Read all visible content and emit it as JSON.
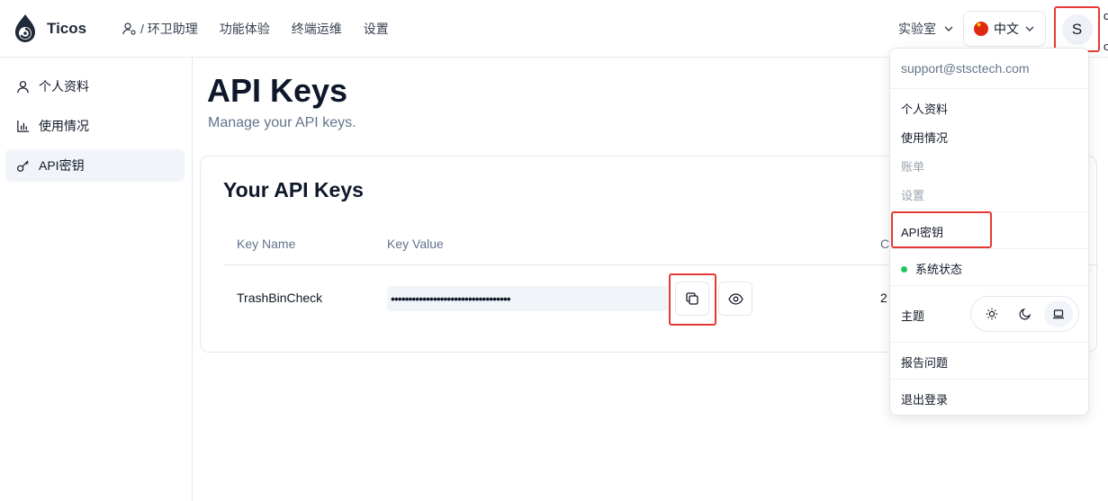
{
  "app": {
    "name": "Ticos"
  },
  "nav": {
    "items": [
      {
        "label": "/ 环卫助理"
      },
      {
        "label": "功能体验"
      },
      {
        "label": "终端运维"
      },
      {
        "label": "设置"
      }
    ],
    "lab_label": "实验室",
    "language_label": "中文",
    "avatar_initial": "S"
  },
  "sidebar": {
    "items": [
      {
        "label": "个人资料",
        "icon": "user-icon"
      },
      {
        "label": "使用情况",
        "icon": "bar-chart-icon"
      },
      {
        "label": "API密钥",
        "icon": "key-icon",
        "active": true
      }
    ]
  },
  "page": {
    "title": "API Keys",
    "subtitle": "Manage your API keys."
  },
  "card": {
    "title": "Your API Keys",
    "columns": [
      "Key Name",
      "Key Value",
      "C"
    ],
    "rows": [
      {
        "name": "TrashBinCheck",
        "value_masked": "••••••••••••••••••••••••••••••••••",
        "created_partial": "2"
      }
    ]
  },
  "menu": {
    "email": "support@stsctech.com",
    "items": {
      "profile": "个人资料",
      "usage": "使用情况",
      "billing": "账单",
      "settings": "设置",
      "api_keys": "API密钥",
      "system_status": "系统状态",
      "theme": "主题",
      "report_issue": "报告问题",
      "logout": "退出登录"
    },
    "theme_active": "system",
    "status_color": "#22c55e"
  },
  "colors": {
    "highlight": "#e53935",
    "active_bg": "#f1f5f9"
  }
}
